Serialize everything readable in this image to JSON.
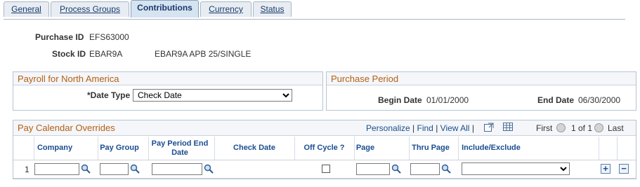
{
  "tabs": [
    {
      "label": "General"
    },
    {
      "label": "Process Groups"
    },
    {
      "label": "Contributions"
    },
    {
      "label": "Currency"
    },
    {
      "label": "Status"
    }
  ],
  "header": {
    "purchase_id_label": "Purchase ID",
    "purchase_id_value": "EFS63000",
    "stock_id_label": "Stock ID",
    "stock_id_value": "EBAR9A",
    "stock_desc": "EBAR9A APB 25/SINGLE"
  },
  "payroll": {
    "title": "Payroll for North America",
    "date_type_label": "*Date Type",
    "date_type_value": "Check Date"
  },
  "purchase_period": {
    "title": "Purchase Period",
    "begin_label": "Begin Date",
    "begin_value": "01/01/2000",
    "end_label": "End Date",
    "end_value": "06/30/2000"
  },
  "grid": {
    "title": "Pay Calendar Overrides",
    "personalize": "Personalize",
    "find": "Find",
    "view_all": "View All",
    "first": "First",
    "range": "1 of 1",
    "last": "Last",
    "columns": {
      "company": "Company",
      "pay_group": "Pay Group",
      "pay_period_end": "Pay Period End Date",
      "check_date": "Check Date",
      "off_cycle": "Off Cycle ?",
      "page": "Page",
      "thru_page": "Thru Page",
      "include_exclude": "Include/Exclude"
    },
    "rows": [
      {
        "num": "1",
        "include_exclude": ""
      }
    ],
    "add_symbol": "+",
    "remove_symbol": "−"
  },
  "colors": {
    "section_title": "#b35f13",
    "link": "#1a4d8f",
    "border": "#b7c4d4"
  }
}
